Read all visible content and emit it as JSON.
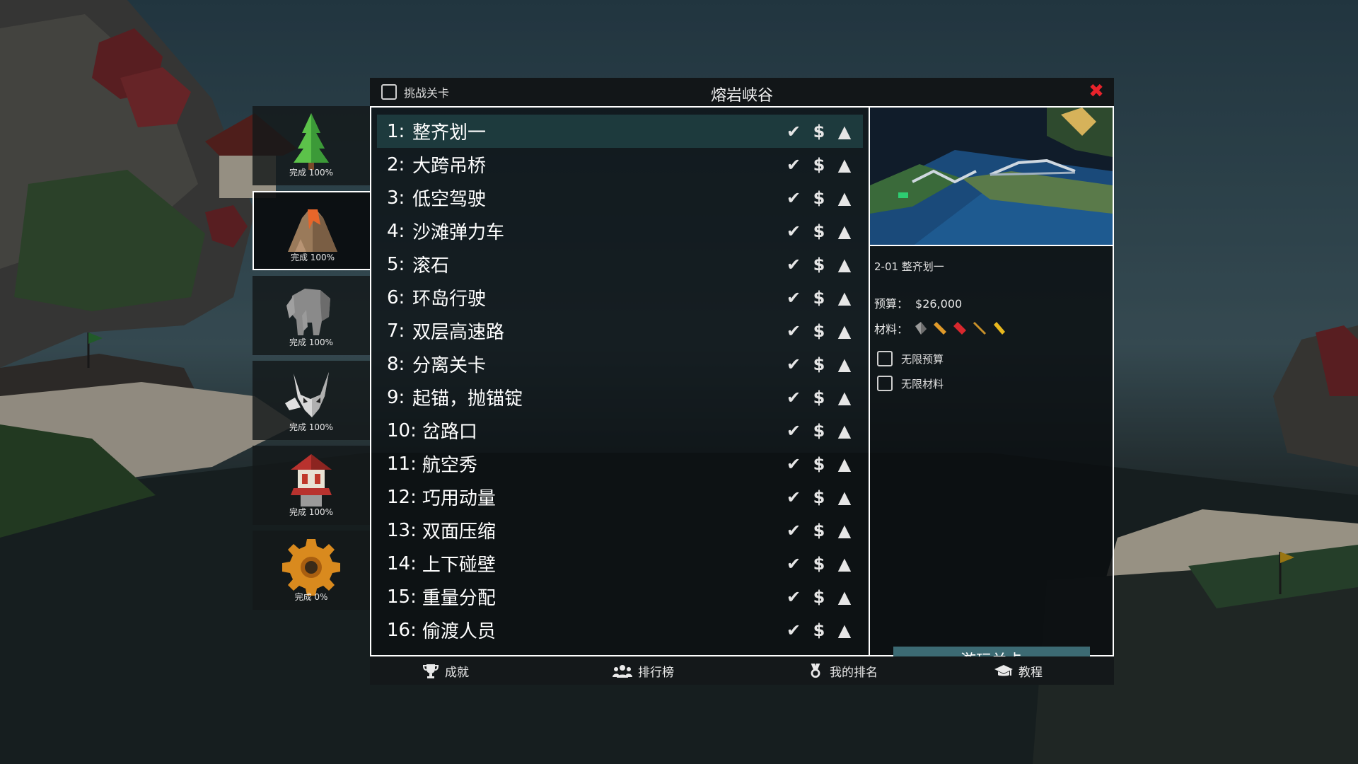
{
  "window": {
    "title": "熔岩峡谷",
    "challenge_label": "挑战关卡"
  },
  "worlds": [
    {
      "icon": "pine-tree-icon",
      "label": "完成 100%"
    },
    {
      "icon": "volcano-icon",
      "label": "完成 100%",
      "active": true
    },
    {
      "icon": "elephant-icon",
      "label": "完成 100%"
    },
    {
      "icon": "horned-skull-icon",
      "label": "完成 100%"
    },
    {
      "icon": "pagoda-lantern-icon",
      "label": "完成 100%"
    },
    {
      "icon": "gear-icon",
      "label": "完成 0%"
    }
  ],
  "levels": [
    {
      "num": "1:",
      "name": "整齐划一",
      "selected": true
    },
    {
      "num": "2:",
      "name": "大跨吊桥"
    },
    {
      "num": "3:",
      "name": "低空驾驶"
    },
    {
      "num": "4:",
      "name": "沙滩弹力车"
    },
    {
      "num": "5:",
      "name": "滚石"
    },
    {
      "num": "6:",
      "name": "环岛行驶"
    },
    {
      "num": "7:",
      "name": "双层高速路"
    },
    {
      "num": "8:",
      "name": "分离关卡"
    },
    {
      "num": "9:",
      "name": "起锚，抛锚锭"
    },
    {
      "num": "10:",
      "name": "岔路口"
    },
    {
      "num": "11:",
      "name": "航空秀"
    },
    {
      "num": "12:",
      "name": "巧用动量"
    },
    {
      "num": "13:",
      "name": "双面压缩"
    },
    {
      "num": "14:",
      "name": "上下碰壁"
    },
    {
      "num": "15:",
      "name": "重量分配"
    },
    {
      "num": "16:",
      "name": "偷渡人员"
    }
  ],
  "level_stats": {
    "check": "✔",
    "dollar": "$",
    "triangle": "▲"
  },
  "detail": {
    "id": "2-01 整齐划一",
    "budget_label": "预算：",
    "budget_value": "$26,000",
    "materials_label": "材料：",
    "materials": [
      "road-icon",
      "wood-icon",
      "steel-icon",
      "rope-icon",
      "cable-icon"
    ],
    "unlimited_budget": "无限预算",
    "unlimited_materials": "无限材料",
    "play_button": "游玩关卡"
  },
  "bottom": {
    "achievements": "成就",
    "leaderboard": "排行榜",
    "my_rank": "我的排名",
    "tutorial": "教程"
  },
  "colors": {
    "accent": "#3c6a73",
    "selected_row": "#1d3a3d",
    "close": "#e8232b"
  }
}
